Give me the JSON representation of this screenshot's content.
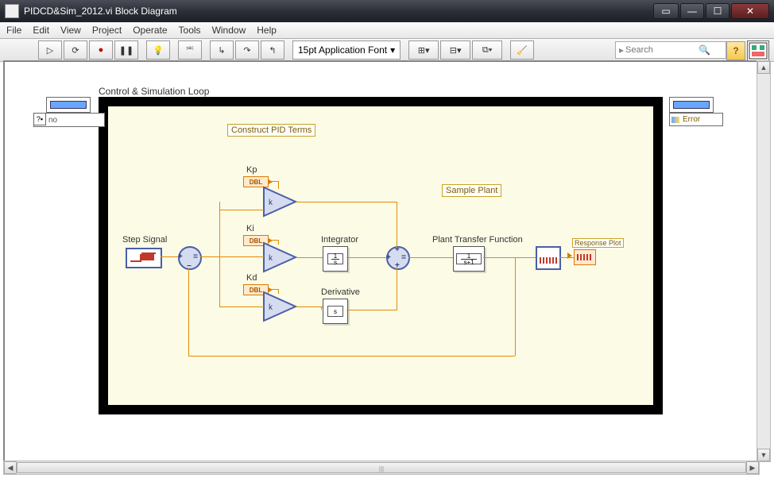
{
  "window": {
    "title": "PIDCD&Sim_2012.vi Block Diagram"
  },
  "menu": {
    "items": [
      "File",
      "Edit",
      "View",
      "Project",
      "Operate",
      "Tools",
      "Window",
      "Help"
    ]
  },
  "toolbar": {
    "font": "15pt Application Font",
    "search_placeholder": "Search",
    "help": "?"
  },
  "diagram": {
    "loop_label": "Control & Simulation Loop",
    "comments": {
      "pid": "Construct PID Terms",
      "plant": "Sample Plant"
    },
    "blocks": {
      "step": "Step Signal",
      "kp": "Kp",
      "ki": "Ki",
      "kd": "Kd",
      "dbl": "DBL",
      "integrator": "Integrator",
      "integrator_sym_top": "1",
      "integrator_sym_bot": "s",
      "derivative": "Derivative",
      "derivative_sym": "s",
      "plant_tf": "Plant Transfer Function",
      "plant_tf_top": "1",
      "plant_tf_bot": "s+1",
      "gain_k": "k",
      "response": "Response Plot"
    },
    "terminals": {
      "left_no": "no",
      "right_err": "Error"
    }
  }
}
